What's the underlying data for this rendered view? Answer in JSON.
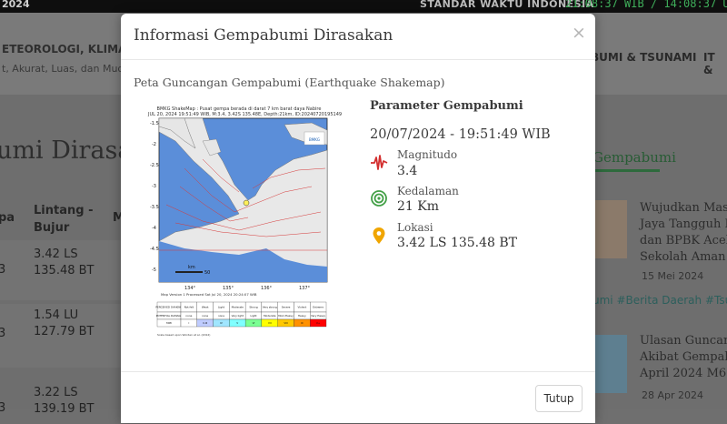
{
  "background": {
    "topbar": {
      "date": "2024",
      "standard_time": "STANDAR WAKTU INDONESIA",
      "clock": "21:08:37 WIB / 14:08:37 UTC"
    },
    "header": {
      "title_fragment": "ETEOROLOGI, KLIMATOLO",
      "tagline_fragment": "t, Akurat, Luas, dan Mudah",
      "nav": [
        "BUMI & TSUNAMI",
        "IT &"
      ]
    },
    "page_title_fragment": "umi Dirasakan",
    "table": {
      "headers": [
        "pa",
        "Lintang -\nBujur",
        "M"
      ],
      "rows": [
        {
          "prefix": "3",
          "coords": "3.42 LS\n135.48 BT"
        },
        {
          "prefix": "3",
          "coords": "1.54 LU\n127.79 BT"
        },
        {
          "prefix": "3",
          "coords": "3.22 LS\n139.19 BT"
        }
      ]
    },
    "sidebar": {
      "title": "Gempabumi",
      "news": [
        {
          "title": "Wujudkan Masy\nJaya Tangguh Be\ndan BPBK Aceh J\nSekolah Aman B",
          "date": "15 Mei 2024"
        },
        {
          "title": "Ulasan Guncang\nAkibat Gempabu\nApril 2024 M6.2",
          "date": "28 Apr 2024"
        }
      ],
      "tags": "umi #Berita Daerah #Tsuna"
    }
  },
  "modal": {
    "title": "Informasi Gempabumi Dirasakan",
    "close_glyph": "×",
    "map_heading": "Peta Guncangan Gempabumi (Earthquake Shakemap)",
    "shakemap": {
      "caption_line1": "BMKG ShakeMap : Pusat gempa berada di darat 7 km barat daya Nabire",
      "caption_line2": "JUL 20, 2024 19:51:49 WIB, M:3.4, 3.42S 135.48E, Depth:21km, ID:20240720195149",
      "lat_ticks": [
        "-1.5",
        "-2",
        "-2.5",
        "-3",
        "-3.5",
        "-4",
        "-4.5",
        "-5"
      ],
      "lon_ticks": [
        "134°",
        "135°",
        "136°",
        "137°"
      ],
      "scale_label": "km",
      "scale_value": "50",
      "logo_text": "BMKG",
      "footer_caption": "Map Version 1 Processed Sat Jul 20, 2024 20:24:07 WIB",
      "legend_headers": [
        "PERCEIVED SHAKING",
        "Not felt",
        "Weak",
        "Light",
        "Moderate",
        "Strong",
        "Very strong",
        "Severe",
        "Violent",
        "Extreme"
      ],
      "legend_damage": [
        "POTENTIAL DAMAGE",
        "none",
        "none",
        "none",
        "Very light",
        "Light",
        "Moderate",
        "Mod./Heavy",
        "Heavy",
        "Very Heavy"
      ],
      "legend_mmi": [
        "MMI",
        "I",
        "II-III",
        "IV",
        "V",
        "VI",
        "VII",
        "VIII",
        "IX",
        "X+"
      ],
      "legend_colors": [
        "#ffffff",
        "#ffffff",
        "#bfccff",
        "#a0e6ff",
        "#80ffff",
        "#7aff93",
        "#ffff00",
        "#ffc800",
        "#ff9100",
        "#ff0000",
        "#c80000"
      ],
      "legend_note": "Scale based upon Worden et al. (2012)"
    },
    "parameters": {
      "title": "Parameter Gempabumi",
      "datetime": "20/07/2024 - 19:51:49 WIB",
      "magnitude_label": "Magnitudo",
      "magnitude_value": "3.4",
      "depth_label": "Kedalaman",
      "depth_value": "21 Km",
      "location_label": "Lokasi",
      "location_value": "3.42 LS 135.48 BT"
    },
    "close_button": "Tutup",
    "colors": {
      "magnitude_icon": "#d32f2f",
      "depth_icon": "#43a047",
      "location_icon": "#f0a500"
    }
  }
}
